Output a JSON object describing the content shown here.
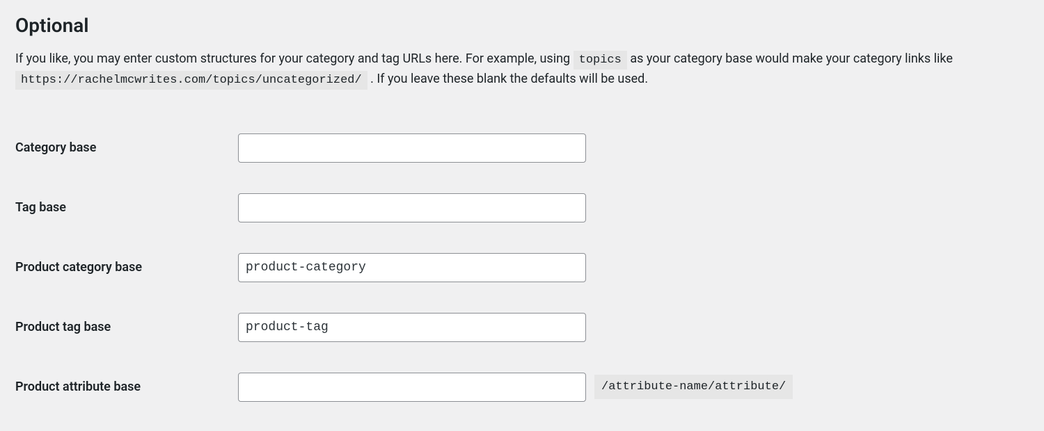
{
  "section": {
    "title": "Optional",
    "description_1": "If you like, you may enter custom structures for your category and tag URLs here. For example, using ",
    "description_code_1": "topics",
    "description_2": " as your category base would make your category links like ",
    "description_code_2": "https://rachelmcwrites.com/topics/uncategorized/",
    "description_3": " . If you leave these blank the defaults will be used."
  },
  "fields": {
    "category_base": {
      "label": "Category base",
      "value": ""
    },
    "tag_base": {
      "label": "Tag base",
      "value": ""
    },
    "product_category_base": {
      "label": "Product category base",
      "value": "product-category"
    },
    "product_tag_base": {
      "label": "Product tag base",
      "value": "product-tag"
    },
    "product_attribute_base": {
      "label": "Product attribute base",
      "value": "",
      "suffix": "/attribute-name/attribute/"
    }
  }
}
